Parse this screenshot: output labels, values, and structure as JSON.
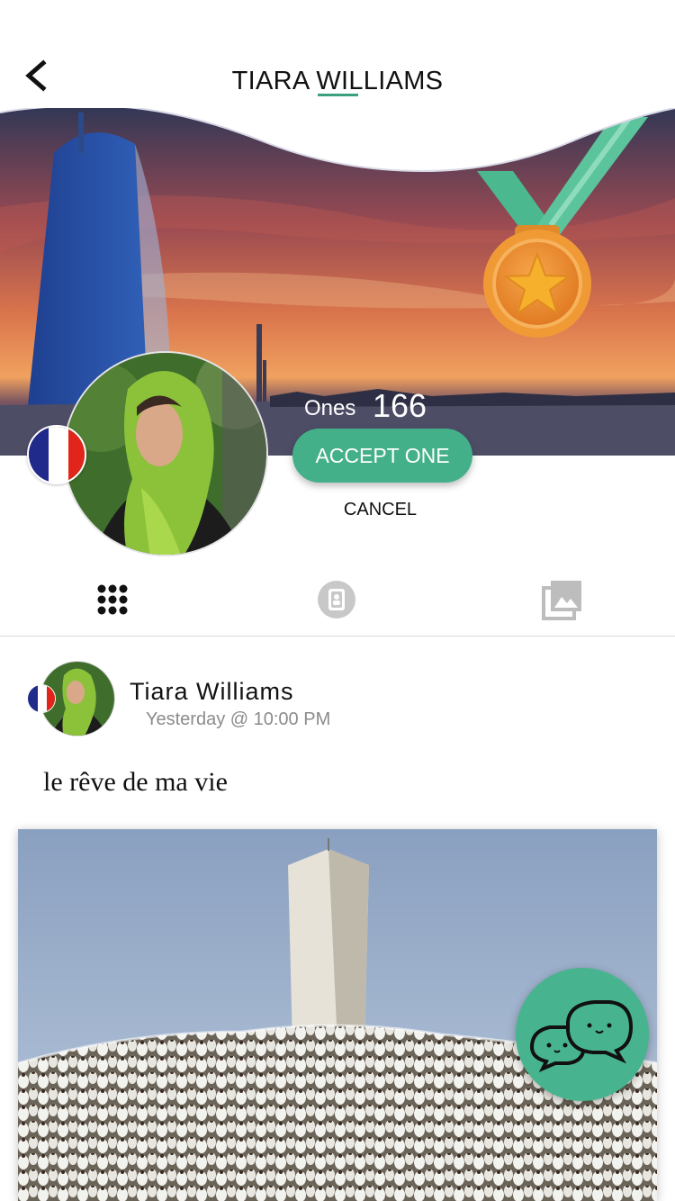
{
  "header": {
    "title": "TIARA WILLIAMS"
  },
  "profile": {
    "ones_label": "Ones",
    "ones_count": "166",
    "accept_label": "ACCEPT ONE",
    "cancel_label": "CANCEL"
  },
  "tabs": [
    {
      "icon": "grid-icon",
      "active": true
    },
    {
      "icon": "contact-card-icon",
      "active": false
    },
    {
      "icon": "photo-gallery-icon",
      "active": false
    }
  ],
  "post": {
    "author": "Tiara Williams",
    "time": "Yesterday @ 10:00 PM",
    "text": "le rêve de ma vie"
  },
  "colors": {
    "accent": "#44b08a",
    "fab": "#47b48f",
    "muted_text": "#8b8b8b"
  }
}
